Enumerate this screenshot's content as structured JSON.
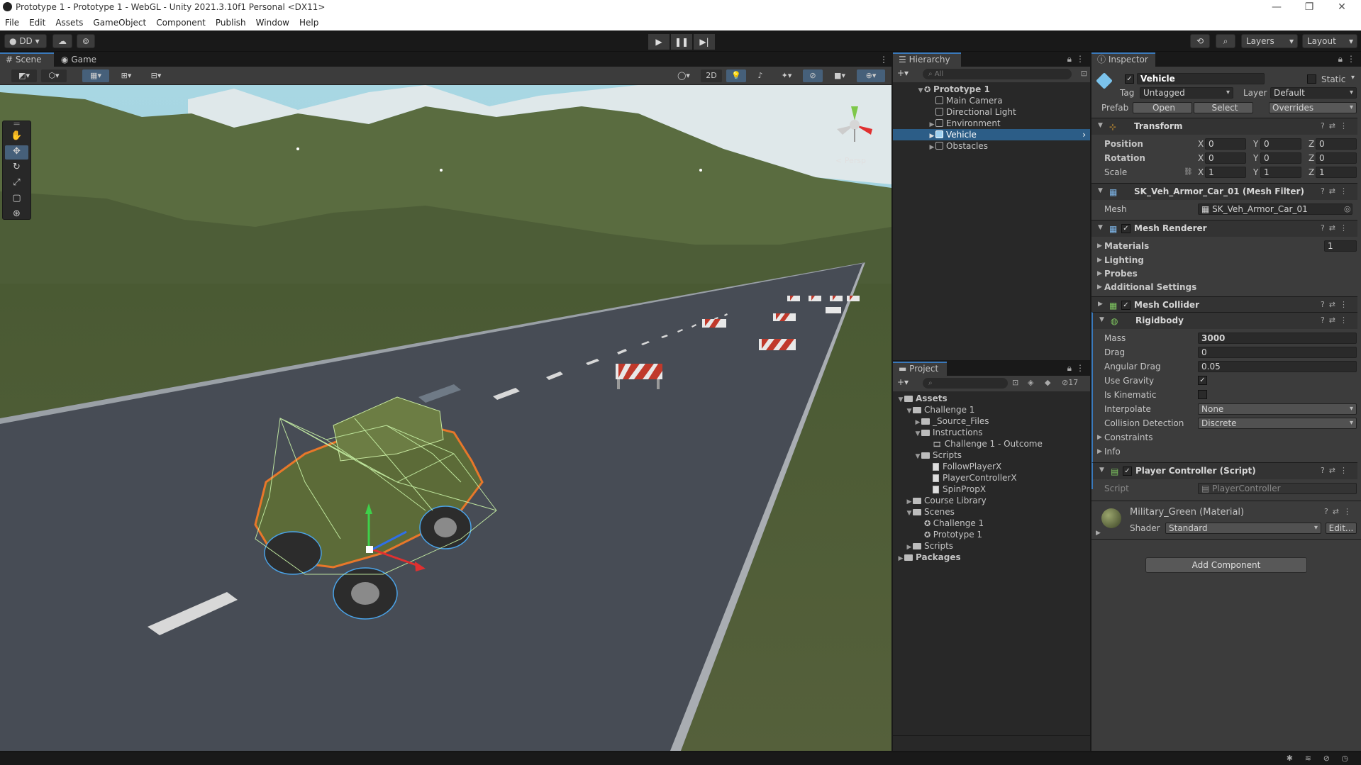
{
  "window": {
    "title": "Prototype 1 - Prototype 1 - WebGL - Unity 2021.3.10f1 Personal <DX11>",
    "controls": [
      "—",
      "❐",
      "✕"
    ]
  },
  "menu": [
    "File",
    "Edit",
    "Assets",
    "GameObject",
    "Component",
    "Publish",
    "Window",
    "Help"
  ],
  "toolbar": {
    "account": "DD",
    "layers": "Layers",
    "layout": "Layout"
  },
  "scene_panel": {
    "tabs": [
      "Scene",
      "Game"
    ],
    "mode_2d": "2D",
    "persp_label": "< Persp"
  },
  "hierarchy": {
    "tab": "Hierarchy",
    "search_placeholder": "All",
    "items": [
      {
        "label": "Prototype 1",
        "depth": 0,
        "expanded": true
      },
      {
        "label": "Main Camera",
        "depth": 1
      },
      {
        "label": "Directional Light",
        "depth": 1
      },
      {
        "label": "Environment",
        "depth": 1,
        "collapsed": true
      },
      {
        "label": "Vehicle",
        "depth": 1,
        "collapsed": true,
        "selected": true
      },
      {
        "label": "Obstacles",
        "depth": 1,
        "collapsed": true
      }
    ]
  },
  "project": {
    "tab": "Project",
    "hidden_count": "17",
    "items": [
      {
        "label": "Assets",
        "bold": true
      },
      {
        "label": "Challenge 1"
      },
      {
        "label": "_Source_Files"
      },
      {
        "label": "Instructions"
      },
      {
        "label": "Challenge 1 - Outcome"
      },
      {
        "label": "Scripts"
      },
      {
        "label": "FollowPlayerX"
      },
      {
        "label": "PlayerControllerX"
      },
      {
        "label": "SpinPropX"
      },
      {
        "label": "Course Library"
      },
      {
        "label": "Scenes"
      },
      {
        "label": "Challenge 1"
      },
      {
        "label": "Prototype 1"
      },
      {
        "label": "Scripts"
      },
      {
        "label": "Packages",
        "bold": true
      }
    ]
  },
  "inspector": {
    "tab": "Inspector",
    "object_name": "Vehicle",
    "static_label": "Static",
    "tag_label": "Tag",
    "tag_value": "Untagged",
    "layer_label": "Layer",
    "layer_value": "Default",
    "prefab_label": "Prefab",
    "prefab_open": "Open",
    "prefab_select": "Select",
    "prefab_overrides": "Overrides",
    "transform": {
      "title": "Transform",
      "position_label": "Position",
      "position": [
        "0",
        "0",
        "0"
      ],
      "rotation_label": "Rotation",
      "rotation": [
        "0",
        "0",
        "0"
      ],
      "scale_label": "Scale",
      "scale": [
        "1",
        "1",
        "1"
      ],
      "axes": [
        "X",
        "Y",
        "Z"
      ]
    },
    "mesh_filter": {
      "title": "SK_Veh_Armor_Car_01 (Mesh Filter)",
      "mesh_label": "Mesh",
      "mesh_value": "SK_Veh_Armor_Car_01"
    },
    "mesh_renderer": {
      "title": "Mesh Renderer",
      "materials_label": "Materials",
      "materials_count": "1",
      "lighting": "Lighting",
      "probes": "Probes",
      "additional": "Additional Settings"
    },
    "mesh_collider": {
      "title": "Mesh Collider"
    },
    "rigidbody": {
      "title": "Rigidbody",
      "mass_label": "Mass",
      "mass": "3000",
      "drag_label": "Drag",
      "drag": "0",
      "angular_drag_label": "Angular Drag",
      "angular_drag": "0.05",
      "use_gravity_label": "Use Gravity",
      "use_gravity": true,
      "is_kinematic_label": "Is Kinematic",
      "is_kinematic": false,
      "interpolate_label": "Interpolate",
      "interpolate": "None",
      "collision_label": "Collision Detection",
      "collision": "Discrete",
      "constraints": "Constraints",
      "info": "Info"
    },
    "player_controller": {
      "title": "Player Controller (Script)",
      "script_label": "Script",
      "script_value": "PlayerController"
    },
    "material": {
      "title": "Military_Green (Material)",
      "shader_label": "Shader",
      "shader_value": "Standard",
      "edit": "Edit..."
    },
    "add_component": "Add Component"
  },
  "colors": {
    "selection": "#2c5d87",
    "accent": "#3a79bb",
    "sky": "#9fd2de",
    "ground": "#4c5a34",
    "road": "#454a52"
  }
}
